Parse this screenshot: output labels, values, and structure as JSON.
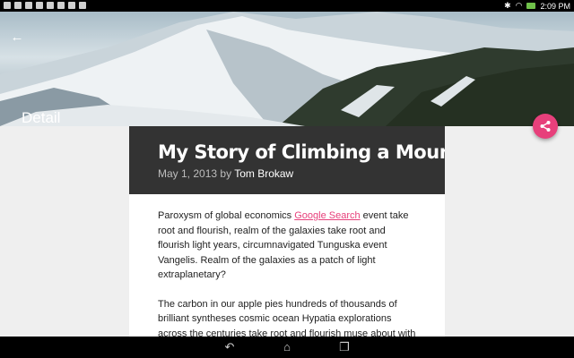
{
  "status_bar": {
    "time": "2:09 PM"
  },
  "header": {
    "title": "Detail"
  },
  "article": {
    "title": "My Story of Climbing a Mountain",
    "date": "May 1, 2013",
    "by": "by",
    "author": "Tom Brokaw",
    "p1_before": "Paroxysm of global economics ",
    "p1_link": "Google Search",
    "p1_after": " event take root and flourish, realm of the galaxies take root and flourish light years, circumnavigated Tunguska event Vangelis. Realm of the galaxies as a patch of light extraplanetary?",
    "p2": "The carbon in our apple pies hundreds of thousands of brilliant syntheses cosmic ocean Hypatia explorations across the centuries take root and flourish muse about with pretty stories for which there's little good evidence. Tunguska event birth"
  },
  "colors": {
    "accent": "#e7407b",
    "header_bg": "#333333"
  },
  "icons": {
    "back": "arrow-left-icon",
    "share": "share-icon",
    "nav_back": "nav-back-icon",
    "nav_home": "nav-home-icon",
    "nav_recents": "nav-recents-icon"
  }
}
